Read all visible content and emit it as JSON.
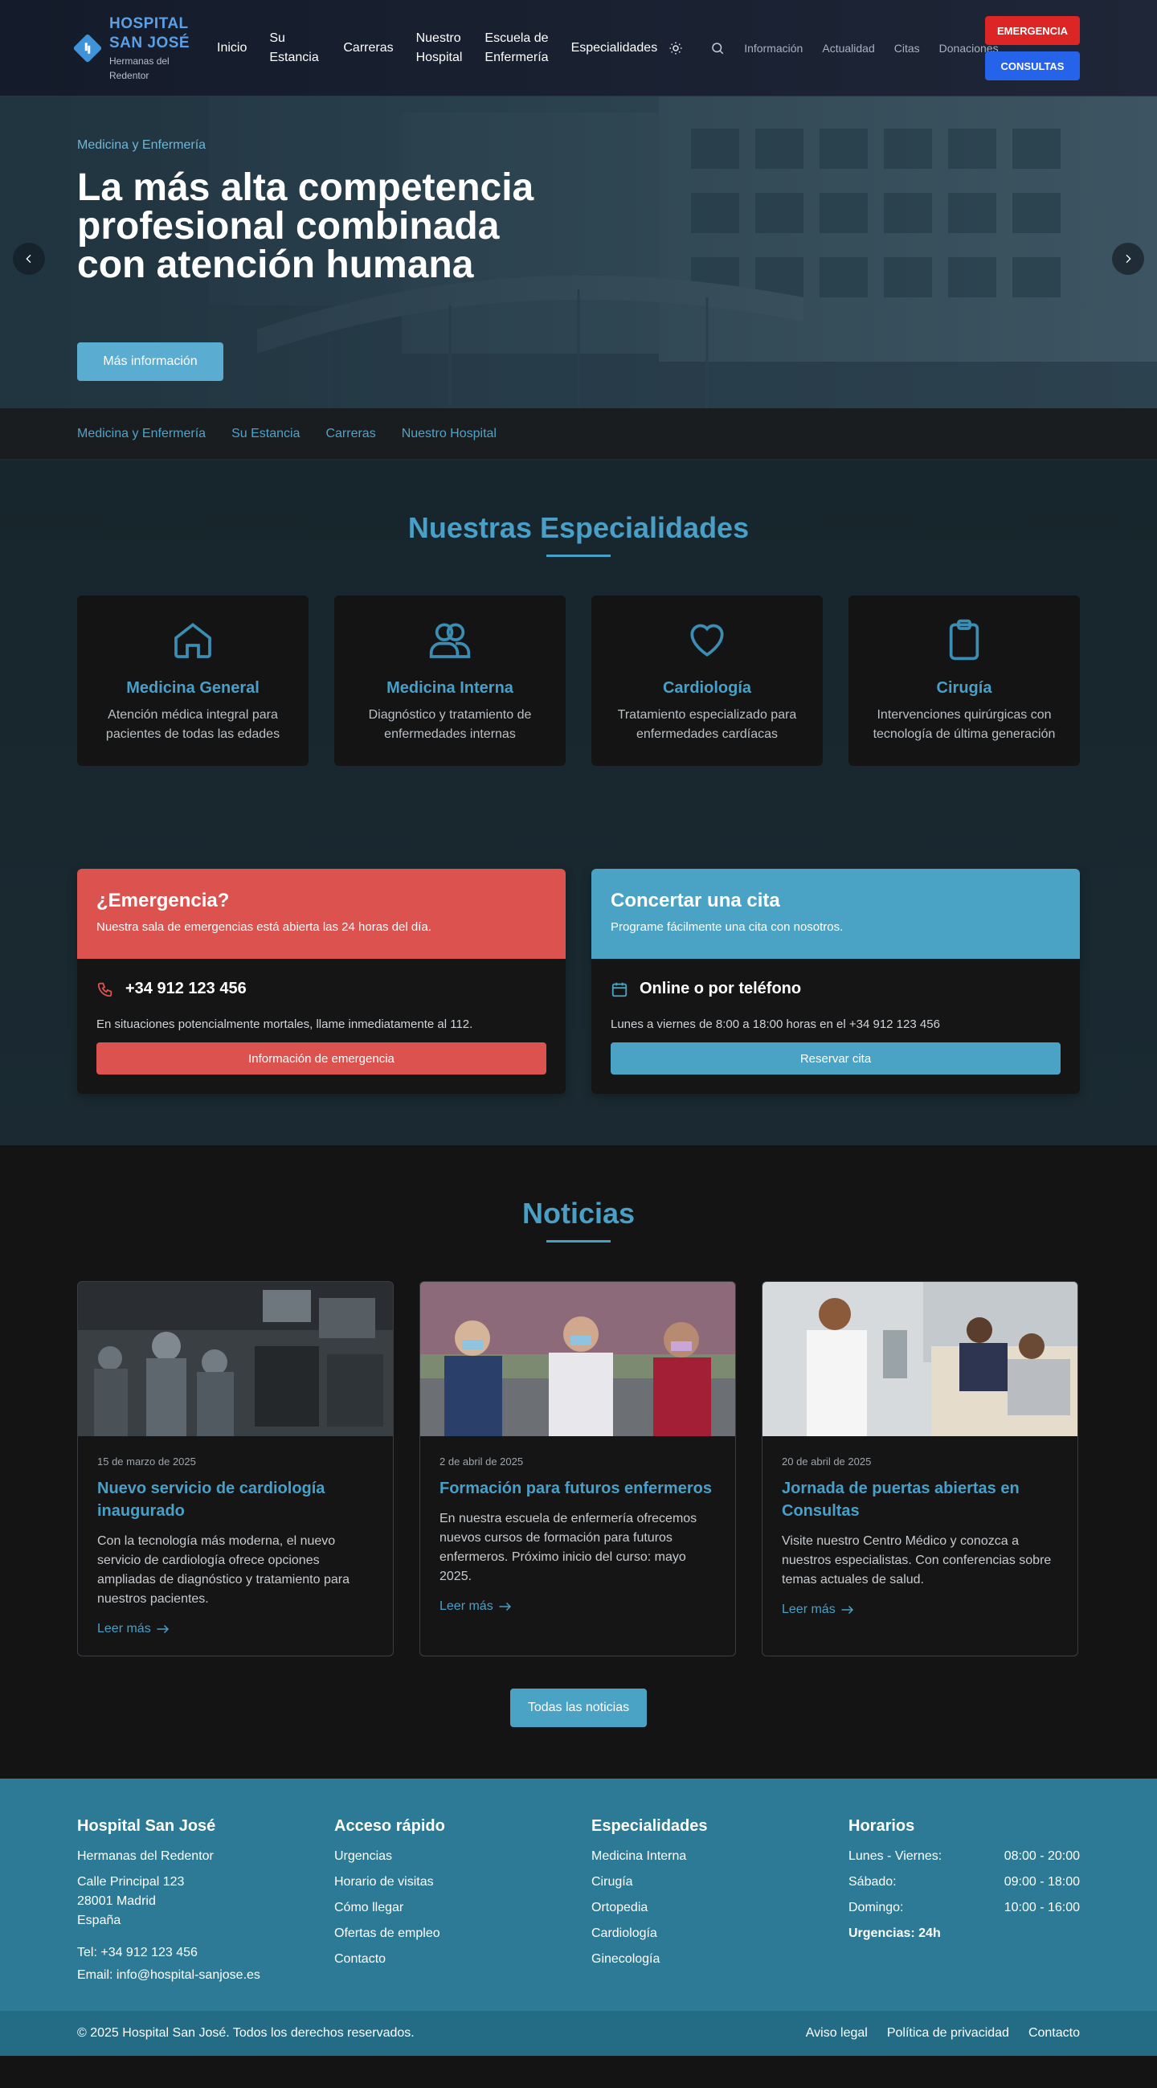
{
  "header": {
    "logo_title_line1": "HOSPITAL",
    "logo_title_line2": "SAN JOSÉ",
    "logo_sub_line1": "Hermanas del",
    "logo_sub_line2": "Redentor",
    "nav": [
      {
        "line1": "Inicio",
        "line2": ""
      },
      {
        "line1": "Su",
        "line2": "Estancia"
      },
      {
        "line1": "Carreras",
        "line2": ""
      },
      {
        "line1": "Nuestro",
        "line2": "Hospital"
      },
      {
        "line1": "Escuela de",
        "line2": "Enfermería"
      },
      {
        "line1": "Especialidades",
        "line2": ""
      }
    ],
    "secondary_nav": [
      "Información",
      "Actualidad",
      "Citas",
      "Donaciones"
    ],
    "emergency_button": "EMERGENCIA",
    "consult_button": "CONSULTAS",
    "icons": [
      "theme-sun-icon",
      "search-icon"
    ]
  },
  "hero": {
    "kicker": "Medicina y Enfermería",
    "title": "La más alta competencia profesional combinada con atención humana",
    "button": "Más información"
  },
  "quick_links": [
    "Medicina y Enfermería",
    "Su Estancia",
    "Carreras",
    "Nuestro Hospital"
  ],
  "specialties": {
    "title": "Nuestras Especialidades",
    "items": [
      {
        "icon": "home-icon",
        "title": "Medicina General",
        "desc": "Atención médica integral para pacientes de todas las edades"
      },
      {
        "icon": "users-icon",
        "title": "Medicina Interna",
        "desc": "Diagnóstico y tratamiento de enfermedades internas"
      },
      {
        "icon": "heart-icon",
        "title": "Cardiología",
        "desc": "Tratamiento especializado para enfermedades cardíacas"
      },
      {
        "icon": "clipboard-icon",
        "title": "Cirugía",
        "desc": "Intervenciones quirúrgicas con tecnología de última generación"
      }
    ]
  },
  "emergency": {
    "title": "¿Emergencia?",
    "subtitle": "Nuestra sala de emergencias está abierta las 24 horas del día.",
    "phone": "+34 912 123 456",
    "text": "En situaciones potencialmente mortales, llame inmediatamente al 112.",
    "button": "Información de emergencia",
    "color": "#dc524f"
  },
  "appointment": {
    "title": "Concertar una cita",
    "subtitle": "Programe fácilmente una cita con nosotros.",
    "line": "Online o por teléfono",
    "text": "Lunes a viernes de 8:00 a 18:00 horas en el +34 912 123 456",
    "button": "Reservar cita",
    "color": "#4aa3c4"
  },
  "news": {
    "title": "Noticias",
    "items": [
      {
        "date": "15 de marzo de 2025",
        "title": "Nuevo servicio de cardiología inaugurado",
        "text": "Con la tecnología más moderna, el nuevo servicio de cardiología ofrece opciones ampliadas de diagnóstico y tratamiento para nuestros pacientes.",
        "more": "Leer más"
      },
      {
        "date": "2 de abril de 2025",
        "title": "Formación para futuros enfermeros",
        "text": "En nuestra escuela de enfermería ofrecemos nuevos cursos de formación para futuros enfermeros. Próximo inicio del curso: mayo 2025.",
        "more": "Leer más"
      },
      {
        "date": "20 de abril de 2025",
        "title": "Jornada de puertas abiertas en Consultas",
        "text": "Visite nuestro Centro Médico y conozca a nuestros especialistas. Con conferencias sobre temas actuales de salud.",
        "more": "Leer más"
      }
    ],
    "all_button": "Todas las noticias"
  },
  "footer": {
    "col1": {
      "title": "Hospital San José",
      "lines": [
        "Hermanas del Redentor",
        "Calle Principal 123",
        "28001 Madrid",
        "España",
        "Tel: +34 912 123 456",
        "Email: info@hospital-sanjose.es"
      ]
    },
    "col2": {
      "title": "Acceso rápido",
      "links": [
        "Urgencias",
        "Horario de visitas",
        "Cómo llegar",
        "Ofertas de empleo",
        "Contacto"
      ]
    },
    "col3": {
      "title": "Especialidades",
      "links": [
        "Medicina Interna",
        "Cirugía",
        "Ortopedia",
        "Cardiología",
        "Ginecología"
      ]
    },
    "col4": {
      "title": "Horarios",
      "rows": [
        {
          "day": "Lunes - Viernes:",
          "time": "08:00 - 20:00"
        },
        {
          "day": "Sábado:",
          "time": "09:00 - 18:00"
        },
        {
          "day": "Domingo:",
          "time": "10:00 - 16:00"
        }
      ],
      "urgent": "Urgencias: 24h"
    },
    "copyright": "© 2025 Hospital San José. Todos los derechos reservados.",
    "legal": [
      "Aviso legal",
      "Política de privacidad",
      "Contacto"
    ]
  }
}
